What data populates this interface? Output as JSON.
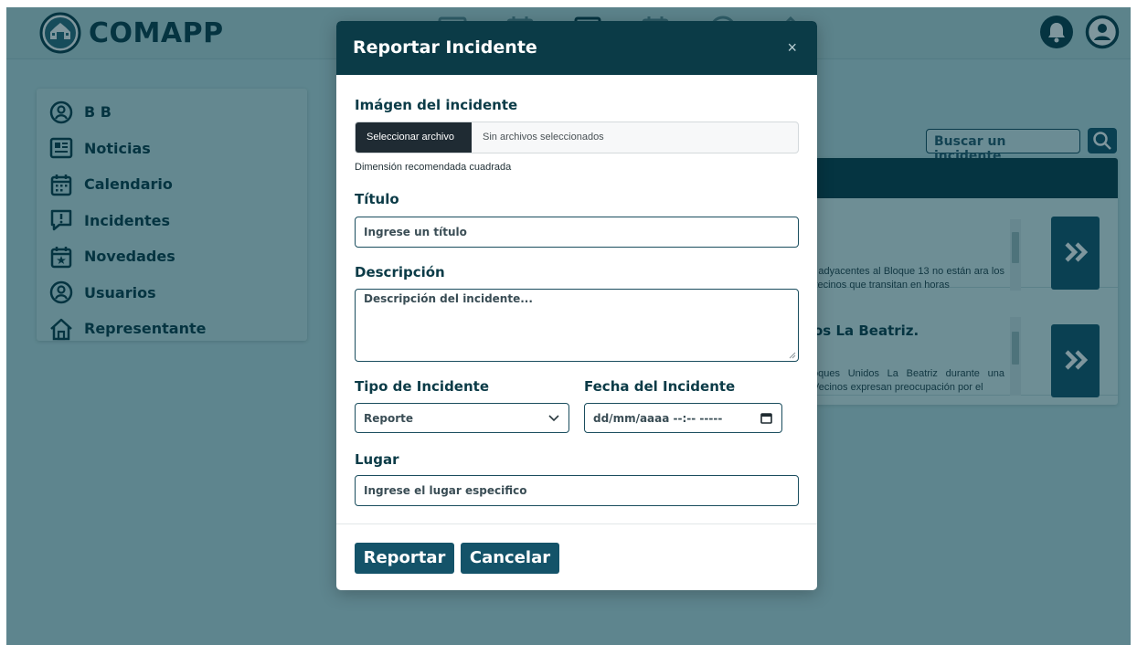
{
  "app": {
    "brand": "COMAPP"
  },
  "sidebar": {
    "items": [
      {
        "label": "B B",
        "icon": "user-circle-icon"
      },
      {
        "label": "Noticias",
        "icon": "newspaper-icon"
      },
      {
        "label": "Calendario",
        "icon": "calendar-icon"
      },
      {
        "label": "Incidentes",
        "icon": "alert-message-icon"
      },
      {
        "label": "Novedades",
        "icon": "calendar-star-icon"
      },
      {
        "label": "Usuarios",
        "icon": "user-circle-icon"
      },
      {
        "label": "Representante",
        "icon": "home-icon"
      }
    ]
  },
  "search": {
    "placeholder": "Buscar un incidente"
  },
  "cards": [
    {
      "title": "",
      "text": ", adyacentes al Bloque 13 no están ara los vecinos que transitan en horas"
    },
    {
      "title": "os La Beatriz.",
      "text": "oques Unidos La Beatriz durante una Vecinos expresan preocupación por el"
    }
  ],
  "modal": {
    "title": "Reportar Incidente",
    "close": "×",
    "image_label": "Imágen del incidente",
    "file_button": "Seleccionar archivo",
    "file_status": "Sin archivos seleccionados",
    "image_hint": "Dimensión recomendada cuadrada",
    "title_label": "Título",
    "title_placeholder": "Ingrese un título",
    "description_label": "Descripción",
    "description_placeholder": "Descripción del incidente...",
    "type_label": "Tipo de Incidente",
    "type_value": "Reporte",
    "date_label": "Fecha del Incidente",
    "date_placeholder": "dd/mm/aaaa --:-- -----",
    "place_label": "Lugar",
    "place_placeholder": "Ingrese el lugar especifico",
    "submit": "Reportar",
    "cancel": "Cancelar"
  },
  "colors": {
    "primary_dark": "#0b3b47",
    "button": "#145369",
    "background": "#bcdde0"
  }
}
